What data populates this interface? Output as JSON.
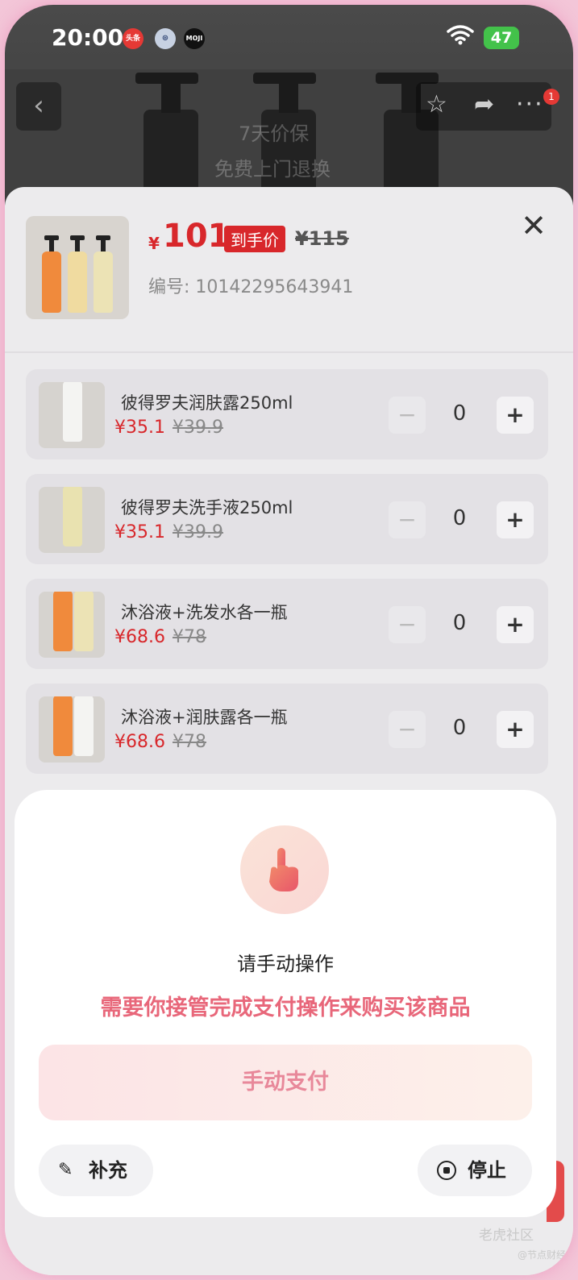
{
  "status_bar": {
    "time": "20:00",
    "app_icons": [
      "头条",
      "⊛",
      "MOJI"
    ],
    "battery": "47"
  },
  "top_nav": {
    "back": "‹",
    "badge": "1",
    "ghost_line1": "7天价保",
    "ghost_line2": "免费上门退换"
  },
  "product": {
    "currency": "¥",
    "price": "101",
    "price_tag": "到手价",
    "original_price": "¥115",
    "sku": "编号: 10142295643941"
  },
  "items": [
    {
      "title": "彼得罗夫润肤露250ml",
      "price": "¥35.1",
      "orig": "¥39.9",
      "qty": "0"
    },
    {
      "title": "彼得罗夫洗手液250ml",
      "price": "¥35.1",
      "orig": "¥39.9",
      "qty": "0"
    },
    {
      "title": "沐浴液+洗发水各一瓶",
      "price": "¥68.6",
      "orig": "¥78",
      "qty": "0"
    },
    {
      "title": "沐浴液+润肤露各一瓶",
      "price": "¥68.6",
      "orig": "¥78",
      "qty": "0"
    }
  ],
  "qty_controls": {
    "minus": "−",
    "plus": "+"
  },
  "dialog": {
    "title": "请手动操作",
    "subtitle": "需要你接管完成支付操作来购买该商品",
    "pay_button": "手动支付",
    "supplement_button": "补充",
    "stop_button": "停止"
  },
  "watermark": {
    "line1": "老虎社区",
    "line2": "@节点财经"
  },
  "colors": {
    "price_red": "#d8272b",
    "accent_pink": "#e8677a",
    "battery_green": "#43c24a"
  }
}
